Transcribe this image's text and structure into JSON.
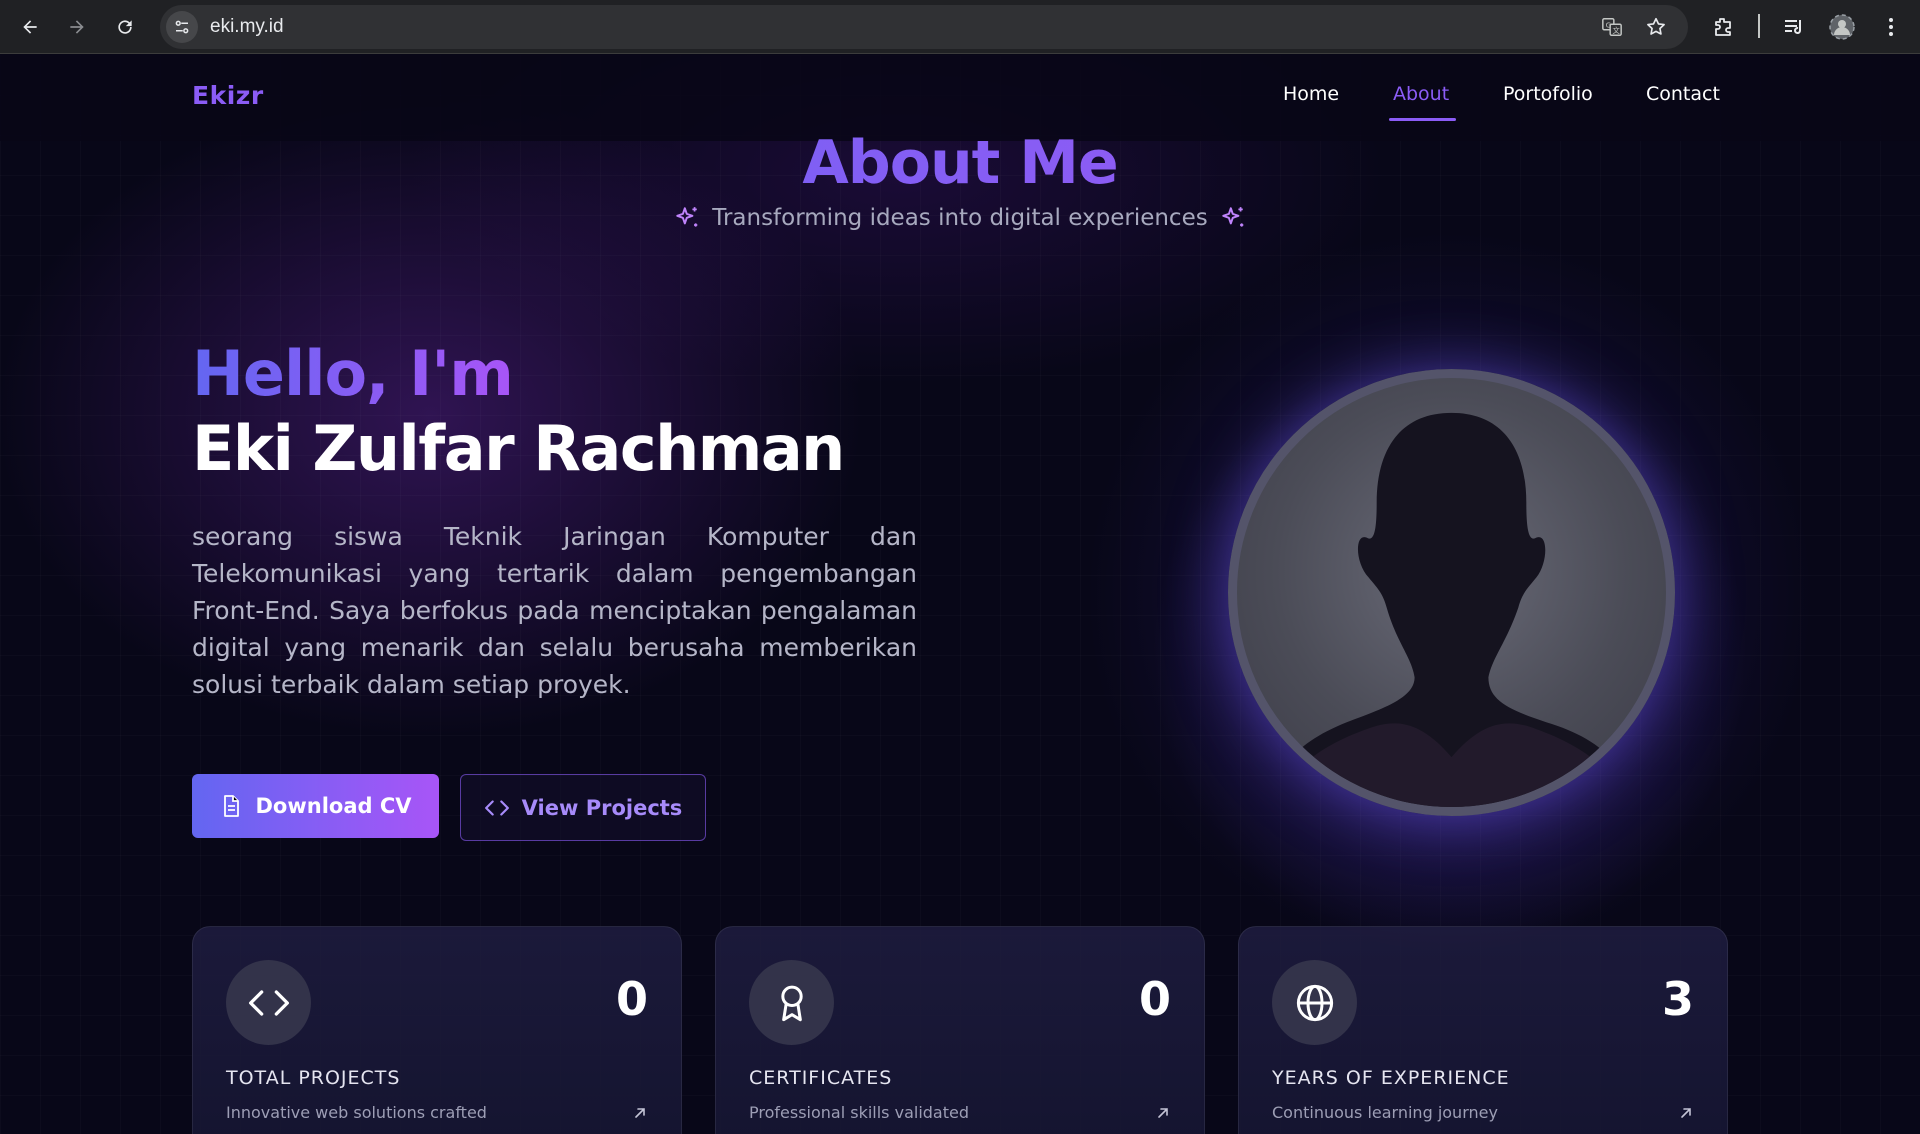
{
  "browser": {
    "url": "eki.my.id",
    "icons": [
      "back-icon",
      "forward-icon",
      "reload-icon",
      "site-info-icon",
      "translate-icon",
      "bookmark-star-icon",
      "extensions-icon",
      "media-control-icon",
      "profile-icon",
      "menu-dots-icon"
    ]
  },
  "site": {
    "brand": "Ekizr",
    "nav": [
      {
        "label": "Home",
        "active": false
      },
      {
        "label": "About",
        "active": true
      },
      {
        "label": "Portofolio",
        "active": false
      },
      {
        "label": "Contact",
        "active": false
      }
    ]
  },
  "about": {
    "title": "About Me",
    "subtitle": "Transforming ideas into digital experiences",
    "greeting": "Hello, I'm",
    "name": "Eki Zulfar Rachman",
    "bio": "seorang siswa Teknik Jaringan Komputer dan Telekomunikasi yang tertarik dalam pengembangan Front-End. Saya berfokus pada menciptakan pengalaman digital yang menarik dan selalu berusaha memberikan solusi terbaik dalam setiap proyek.",
    "buttons": {
      "download_cv": "Download CV",
      "view_projects": "View Projects"
    }
  },
  "stats": [
    {
      "icon": "code-icon",
      "value": "0",
      "label": "TOTAL PROJECTS",
      "description": "Innovative web solutions crafted"
    },
    {
      "icon": "award-icon",
      "value": "0",
      "label": "CERTIFICATES",
      "description": "Professional skills validated"
    },
    {
      "icon": "globe-icon",
      "value": "3",
      "label": "YEARS OF EXPERIENCE",
      "description": "Continuous learning journey"
    }
  ],
  "colors": {
    "accent_start": "#6366f1",
    "accent_end": "#a855f7",
    "background": "#080718",
    "chrome": "#202124"
  }
}
